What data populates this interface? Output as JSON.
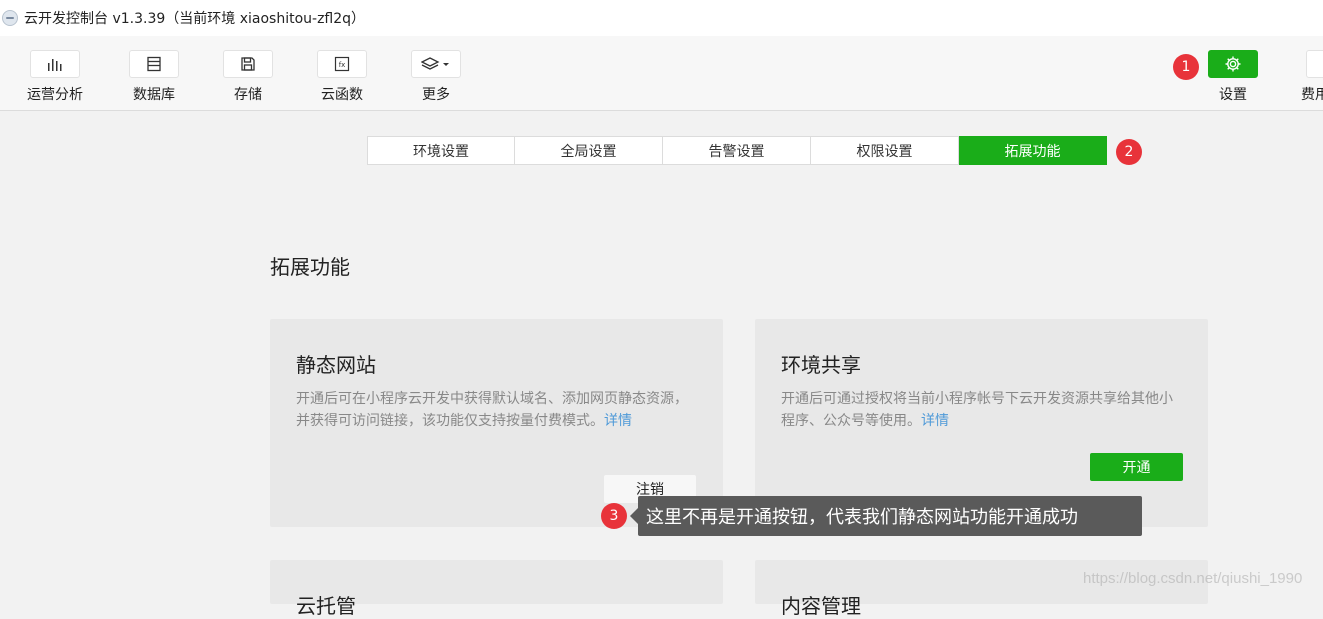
{
  "window": {
    "title": "云开发控制台 v1.3.39（当前环境 xiaoshitou-zfl2q）"
  },
  "toolbar": {
    "items": [
      {
        "label": "运营分析",
        "icon": "bar-chart-icon"
      },
      {
        "label": "数据库",
        "icon": "database-icon"
      },
      {
        "label": "存储",
        "icon": "save-icon"
      },
      {
        "label": "云函数",
        "icon": "function-icon"
      },
      {
        "label": "更多",
        "icon": "layers-icon"
      }
    ],
    "settings_label": "设置",
    "cost_label": "费用"
  },
  "badges": {
    "b1": "1",
    "b2": "2",
    "b3": "3"
  },
  "tabs": [
    {
      "label": "环境设置"
    },
    {
      "label": "全局设置"
    },
    {
      "label": "告警设置"
    },
    {
      "label": "权限设置"
    },
    {
      "label": "拓展功能",
      "active": true
    }
  ],
  "section": {
    "title": "拓展功能"
  },
  "cards": [
    {
      "title": "静态网站",
      "desc": "开通后可在小程序云开发中获得默认域名、添加网页静态资源，并获得可访问链接，该功能仅支持按量付费模式。",
      "link": "详情",
      "button": "注销"
    },
    {
      "title": "环境共享",
      "desc": "开通后可通过授权将当前小程序帐号下云开发资源共享给其他小程序、公众号等使用。",
      "link": "详情",
      "button": "开通"
    },
    {
      "title": "云托管"
    },
    {
      "title": "内容管理"
    }
  ],
  "tooltip": {
    "text": "这里不再是开通按钮，代表我们静态网站功能开通成功"
  },
  "watermark": "https://blog.csdn.net/qiushi_1990",
  "colors": {
    "accent": "#1aad19",
    "badge": "#e8333a",
    "link": "#4f9ad8"
  }
}
